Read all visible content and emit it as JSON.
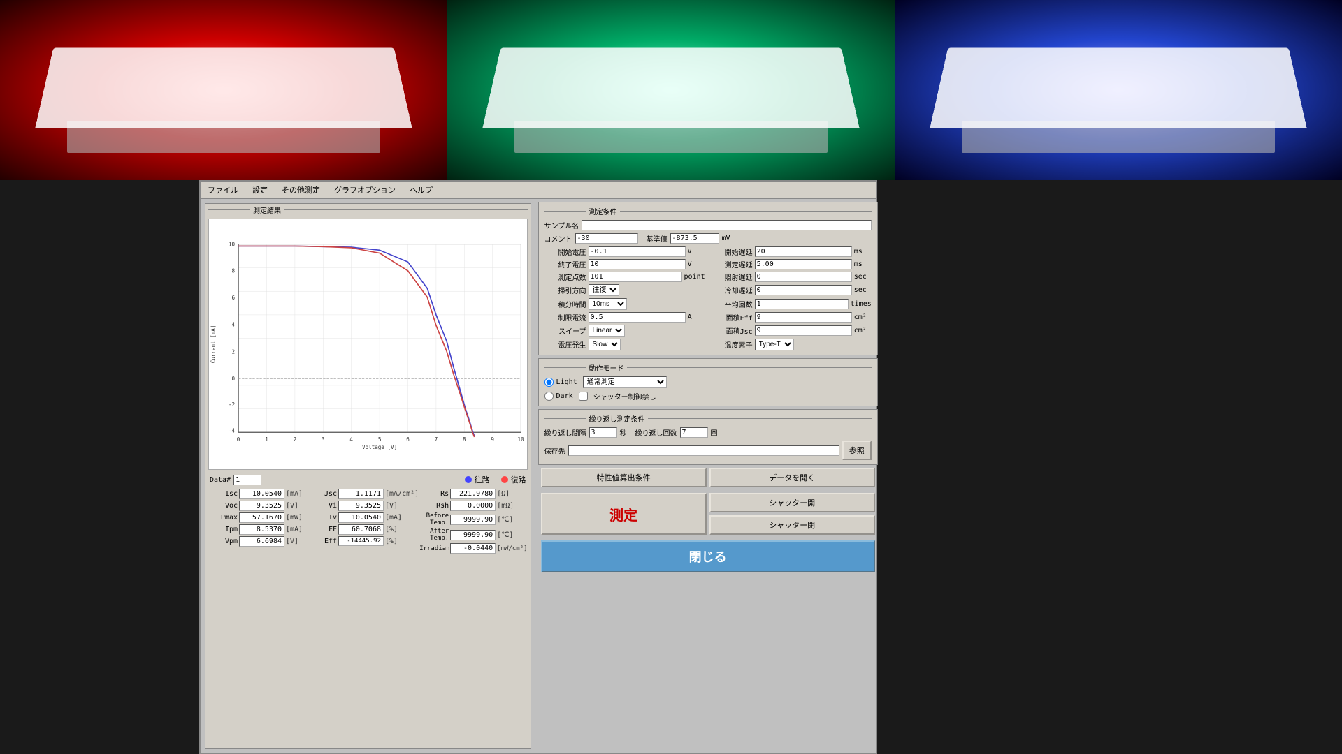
{
  "photos": [
    {
      "color": "red",
      "label": "red-panel"
    },
    {
      "color": "green",
      "label": "green-panel"
    },
    {
      "color": "blue",
      "label": "blue-panel"
    }
  ],
  "menubar": {
    "items": [
      "ファイル",
      "設定",
      "その他測定",
      "グラフオプション",
      "ヘルプ"
    ]
  },
  "left_section_title": "測定結果",
  "chart": {
    "x_label": "Voltage [V]",
    "y_label": "Current [mA]",
    "x_min": 0,
    "x_max": 10,
    "y_min": -4,
    "y_max": 10,
    "x_ticks": [
      0,
      1,
      2,
      3,
      4,
      5,
      6,
      7,
      8,
      9,
      10
    ],
    "y_ticks": [
      -4,
      -2,
      0,
      2,
      4,
      6,
      8,
      10
    ]
  },
  "data_num_label": "Data#",
  "data_num_value": "1",
  "direction_forward": "往路",
  "direction_backward": "復路",
  "measurements": {
    "left_col": [
      {
        "label": "Isc",
        "value": "10.0540",
        "unit": "[mA]"
      },
      {
        "label": "Voc",
        "value": "9.3525",
        "unit": "[V]"
      },
      {
        "label": "Pmax",
        "value": "57.1670",
        "unit": "[mW]"
      },
      {
        "label": "Ipm",
        "value": "8.5370",
        "unit": "[mA]"
      },
      {
        "label": "Vpm",
        "value": "6.6984",
        "unit": "[V]"
      }
    ],
    "mid_col": [
      {
        "label": "Jsc",
        "value": "1.1171",
        "unit": "[mA/cm²]"
      },
      {
        "label": "Vi",
        "value": "9.3525",
        "unit": "[V]"
      },
      {
        "label": "Iv",
        "value": "10.0540",
        "unit": "[mA]"
      },
      {
        "label": "FF",
        "value": "60.7068",
        "unit": "[%]"
      },
      {
        "label": "Eff",
        "value": "-14445.92",
        "unit": "[%]"
      }
    ],
    "right_col": [
      {
        "label": "Rs",
        "value": "221.9780",
        "unit": "[Ω]"
      },
      {
        "label": "Rsh",
        "value": "0.0000",
        "unit": "[mΩ]"
      },
      {
        "label": "Before Temp.",
        "value": "9999.90",
        "unit": "[℃]"
      },
      {
        "label": "After Temp.",
        "value": "9999.90",
        "unit": "[℃]"
      },
      {
        "label": "Irradiance",
        "value": "-0.0440",
        "unit": "[mW/cm²]"
      }
    ]
  },
  "right_section_title": "測定条件",
  "conditions": {
    "sample_label": "サンプル名",
    "sample_value": "",
    "comment_label": "コメント",
    "comment_value": "-30",
    "kijun_label": "基準値",
    "kijun_value": "-873.5",
    "kijun_unit": "mV",
    "fields": [
      {
        "label": "開始電圧",
        "value": "-0.1",
        "unit": "V",
        "right_label": "開始遅延",
        "right_value": "20",
        "right_unit": "ms"
      },
      {
        "label": "終了電圧",
        "value": "10",
        "unit": "V",
        "right_label": "測定遅延",
        "right_value": "5.00",
        "right_unit": "ms"
      },
      {
        "label": "測定点数",
        "value": "101",
        "unit": "point",
        "right_label": "照射遅延",
        "right_value": "0",
        "right_unit": "sec"
      },
      {
        "label": "掃引方向",
        "value": "往復",
        "unit": "",
        "right_label": "冷却遅延",
        "right_value": "0",
        "right_unit": "sec"
      },
      {
        "label": "積分時間",
        "value": "10ms",
        "unit": "",
        "right_label": "平均回数",
        "right_value": "1",
        "right_unit": "times"
      },
      {
        "label": "制限電流",
        "value": "0.5",
        "unit": "A",
        "right_label": "面積Eff",
        "right_value": "9",
        "right_unit": "cm²"
      },
      {
        "label": "スイープ",
        "value": "Linear",
        "unit": "",
        "right_label": "面積Jsc",
        "right_value": "9",
        "right_unit": "cm²"
      },
      {
        "label": "電圧発生",
        "value": "Slow",
        "unit": "",
        "right_label": "温度素子",
        "right_value": "Type-T",
        "right_unit": ""
      }
    ]
  },
  "mode_section_title": "動作モード",
  "mode": {
    "light_label": "Light",
    "dark_label": "Dark",
    "mode_options": [
      "通常測定"
    ],
    "mode_selected": "通常測定",
    "shutter_label": "シャッター制御禁し"
  },
  "repeat_section_title": "繰り返し測定条件",
  "repeat": {
    "interval_label": "繰り返し間隔",
    "interval_value": "3",
    "interval_unit": "秒",
    "count_label": "繰り返し回数",
    "count_value": "7",
    "count_unit": "回",
    "save_label": "保存先",
    "save_value": "",
    "browse_label": "参照"
  },
  "buttons": {
    "char_calc": "特性値算出条件",
    "open_data": "データを開く",
    "shutter_open": "シャッター開",
    "shutter_close": "シャッター閉",
    "measure": "測定",
    "close": "閉じる"
  }
}
